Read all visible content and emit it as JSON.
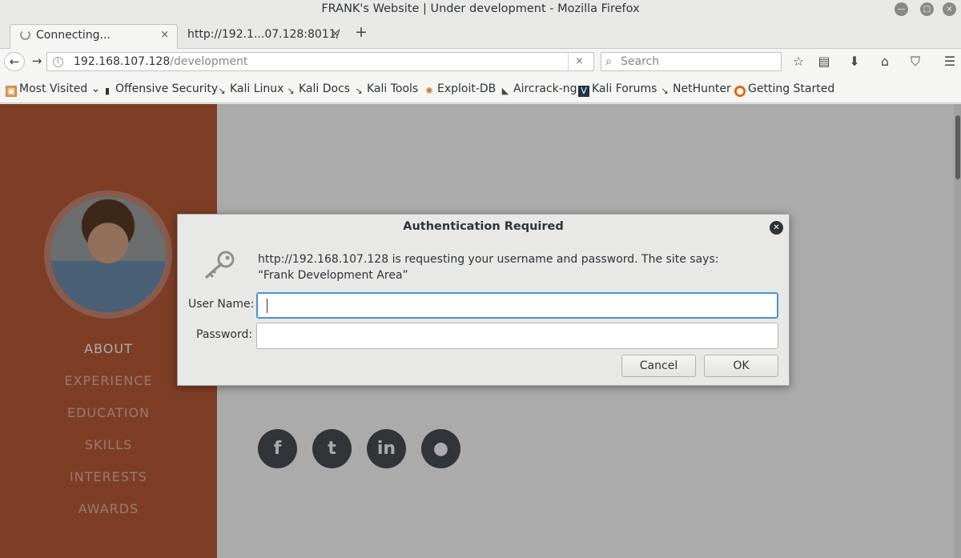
{
  "window": {
    "title": "FRANK's Website | Under development - Mozilla Firefox"
  },
  "tabs": [
    {
      "label": "Connecting...",
      "close": "×"
    },
    {
      "label": "http://192.1...07.128:8011/",
      "close": "×"
    }
  ],
  "newtab": "+",
  "nav": {
    "back": "←",
    "forward": "→",
    "url_host": "192.168.107.128",
    "url_path": "/development",
    "url_clear": "×",
    "search_placeholder": "Search"
  },
  "bookmarks": [
    {
      "label": "Most Visited",
      "icon": "folder-icon"
    },
    {
      "label": "Offensive Security",
      "icon": "offsec-icon"
    },
    {
      "label": "Kali Linux",
      "icon": "kali-icon"
    },
    {
      "label": "Kali Docs",
      "icon": "kali-icon"
    },
    {
      "label": "Kali Tools",
      "icon": "kali-icon"
    },
    {
      "label": "Exploit-DB",
      "icon": "exploit-db-icon"
    },
    {
      "label": "Aircrack-ng",
      "icon": "aircrack-icon"
    },
    {
      "label": "Kali Forums",
      "icon": "forums-icon"
    },
    {
      "label": "NetHunter",
      "icon": "kali-icon"
    },
    {
      "label": "Getting Started",
      "icon": "firefox-icon"
    }
  ],
  "sidebar": {
    "items": [
      {
        "label": "ABOUT"
      },
      {
        "label": "EXPERIENCE"
      },
      {
        "label": "EDUCATION"
      },
      {
        "label": "SKILLS"
      },
      {
        "label": "INTERESTS"
      },
      {
        "label": "AWARDS"
      }
    ]
  },
  "social": [
    {
      "name": "facebook-icon",
      "glyph": "f"
    },
    {
      "name": "twitter-icon",
      "glyph": "t"
    },
    {
      "name": "linkedin-icon",
      "glyph": "in"
    },
    {
      "name": "github-icon",
      "glyph": "●"
    }
  ],
  "dialog": {
    "title": "Authentication Required",
    "message": "http://192.168.107.128 is requesting your username and password. The site says: “Frank Development Area”",
    "username_label": "User Name:",
    "password_label": "Password:",
    "username_value": "",
    "password_value": "",
    "cancel_label": "Cancel",
    "ok_label": "OK"
  }
}
